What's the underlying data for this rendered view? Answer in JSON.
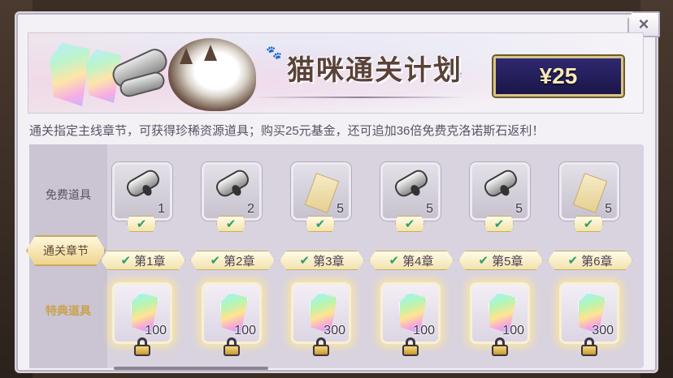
{
  "header": {
    "title": "猫咪通关计划",
    "price": "¥25",
    "close_symbol": "×"
  },
  "description": "通关指定主线章节，可获得珍稀资源道具；购买25元基金，还可追加36倍免费克洛诺斯石返利！",
  "rows": {
    "free_label": "免费道具",
    "chapter_label": "通关章节",
    "special_label": "特典道具"
  },
  "free_items": [
    {
      "icon": "scroll-icon",
      "count": "1"
    },
    {
      "icon": "scroll-icon",
      "count": "2"
    },
    {
      "icon": "ticket-icon",
      "count": "5"
    },
    {
      "icon": "scroll-icon",
      "count": "5"
    },
    {
      "icon": "scroll-icon",
      "count": "5"
    },
    {
      "icon": "ticket-icon",
      "count": "5"
    }
  ],
  "chapters": [
    {
      "label": "第1章",
      "check": "✔"
    },
    {
      "label": "第2章",
      "check": "✔"
    },
    {
      "label": "第3章",
      "check": "✔"
    },
    {
      "label": "第4章",
      "check": "✔"
    },
    {
      "label": "第5章",
      "check": "✔"
    },
    {
      "label": "第6章",
      "check": "✔"
    }
  ],
  "special_items": [
    {
      "icon": "crystal-icon",
      "count": "100"
    },
    {
      "icon": "crystal-icon",
      "count": "100"
    },
    {
      "icon": "crystal-icon",
      "count": "300"
    },
    {
      "icon": "crystal-icon",
      "count": "100"
    },
    {
      "icon": "crystal-icon",
      "count": "100"
    },
    {
      "icon": "crystal-icon",
      "count": "300"
    }
  ],
  "colors": {
    "price_bg": "#1b1648",
    "price_text": "#f8e8b9",
    "check_green": "#2e9e6a",
    "special_label_gold": "#c9a24a"
  }
}
